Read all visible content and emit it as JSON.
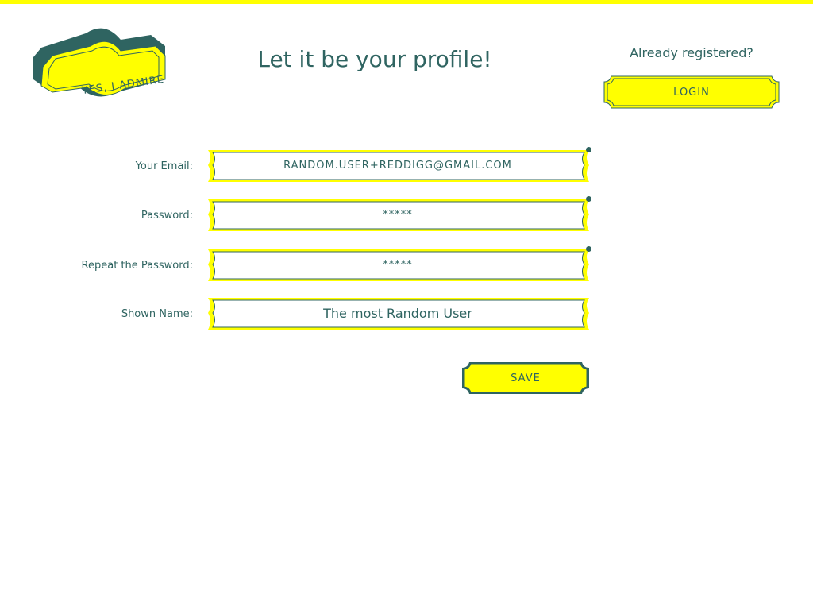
{
  "header": {
    "logo_text": "YES, I ADMIRE",
    "title": "Let it be your profile!",
    "already_registered": "Already registered?",
    "login_label": "LOGIN"
  },
  "form": {
    "email_label": "Your Email:",
    "email_value": "RANDOM.USER+REDDIGG@GMAIL.COM",
    "password_label": "Password:",
    "password_value": "*****",
    "repeat_password_label": "Repeat the Password:",
    "repeat_password_value": "*****",
    "shown_name_label": "Shown Name:",
    "shown_name_value": "The most Random User",
    "save_label": "SAVE"
  },
  "colors": {
    "accent": "#ffff00",
    "primary": "#2f6461",
    "background": "#ffffff"
  }
}
